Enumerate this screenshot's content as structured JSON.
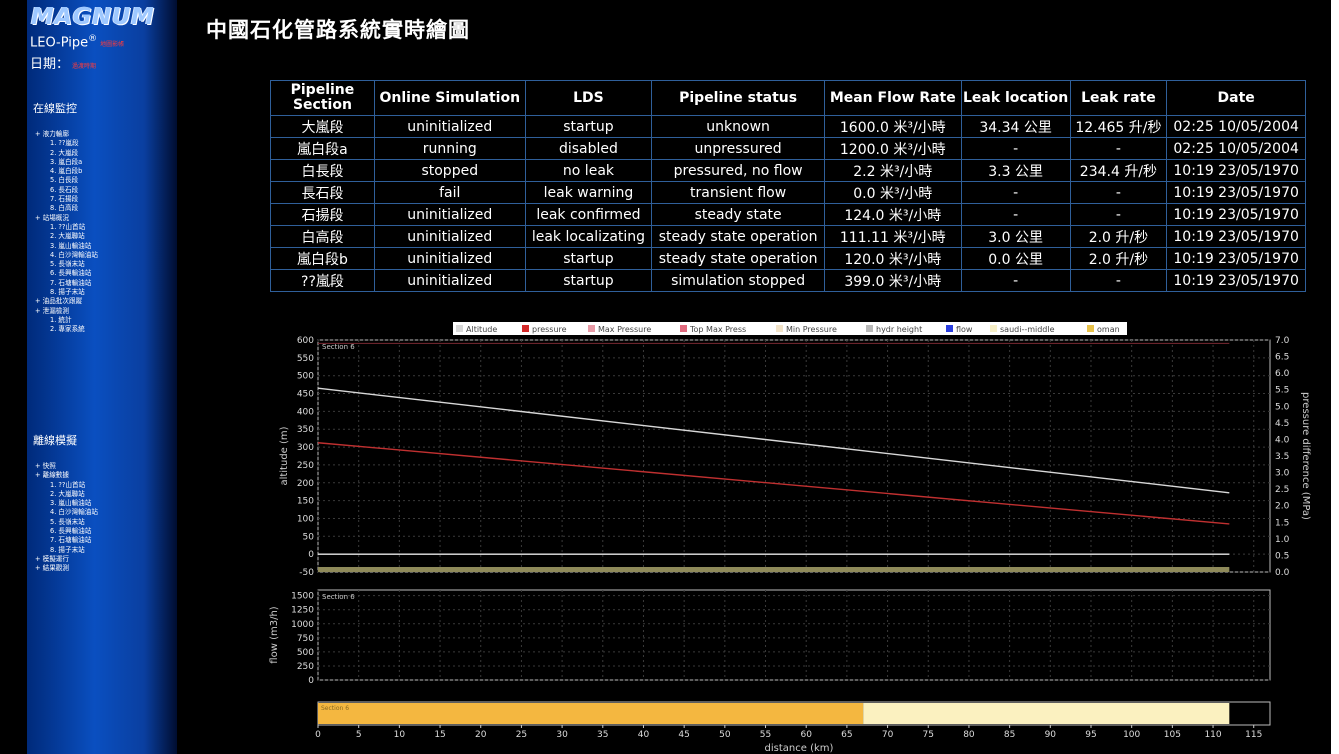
{
  "sidebar": {
    "logo": "MAGNUM",
    "product": "LEO-Pipe",
    "product_mark": "®",
    "product_tag": "地圖影帳",
    "date_label": "日期：",
    "date_value": "過渡時期",
    "section1_title": "在線監控",
    "section1_items": [
      {
        "label": "液力輪廓",
        "level": 1
      },
      {
        "label": "1. ??嵐段",
        "level": 2
      },
      {
        "label": "2. 大嵐段",
        "level": 2
      },
      {
        "label": "3. 嵐白段a",
        "level": 2
      },
      {
        "label": "4. 嵐白段b",
        "level": 2
      },
      {
        "label": "5. 白長段",
        "level": 2
      },
      {
        "label": "6. 長石段",
        "level": 2
      },
      {
        "label": "7. 石揚段",
        "level": 2
      },
      {
        "label": "8. 白高段",
        "level": 2
      },
      {
        "label": "站場概況",
        "level": 1
      },
      {
        "label": "1. ??山首站",
        "level": 2
      },
      {
        "label": "2. 大嵐聯站",
        "level": 2
      },
      {
        "label": "3. 嵐山輸油站",
        "level": 2
      },
      {
        "label": "4. 白沙灣輸油站",
        "level": 2
      },
      {
        "label": "5. 長嶺末站",
        "level": 2
      },
      {
        "label": "6. 長興輸油站",
        "level": 2
      },
      {
        "label": "7. 石塘輸油站",
        "level": 2
      },
      {
        "label": "8. 揚子末站",
        "level": 2
      },
      {
        "label": "油品批次跟蹤",
        "level": 1
      },
      {
        "label": "泄漏檢測",
        "level": 1
      },
      {
        "label": "1. 統計",
        "level": 2
      },
      {
        "label": "2. 專家系統",
        "level": 2
      }
    ],
    "section2_title": "離線模擬",
    "section2_items": [
      {
        "label": "快照",
        "level": 1
      },
      {
        "label": "離線數據",
        "level": 1
      },
      {
        "label": "1. ??山首站",
        "level": 2
      },
      {
        "label": "2. 大嵐聯站",
        "level": 2
      },
      {
        "label": "3. 嵐山輸油站",
        "level": 2
      },
      {
        "label": "4. 白沙灣輸油站",
        "level": 2
      },
      {
        "label": "5. 長嶺末站",
        "level": 2
      },
      {
        "label": "6. 長興輸油站",
        "level": 2
      },
      {
        "label": "7. 石塘輸油站",
        "level": 2
      },
      {
        "label": "8. 揚子末站",
        "level": 2
      },
      {
        "label": "模擬運行",
        "level": 1
      },
      {
        "label": "結果觀測",
        "level": 1
      }
    ]
  },
  "header": {
    "title": "中國石化管路系統實時繪圖"
  },
  "table": {
    "columns": [
      "Pipeline Section",
      "Online Simulation",
      "LDS",
      "Pipeline status",
      "Mean Flow Rate",
      "Leak location",
      "Leak rate",
      "Date"
    ],
    "rows": [
      [
        "大嵐段",
        "uninitialized",
        "startup",
        "unknown",
        "1600.0 米³/小時",
        "34.34 公里",
        "12.465 升/秒",
        "02:25 10/05/2004"
      ],
      [
        "嵐白段a",
        "running",
        "disabled",
        "unpressured",
        "1200.0 米³/小時",
        "-",
        "-",
        "02:25 10/05/2004"
      ],
      [
        "白長段",
        "stopped",
        "no leak",
        "pressured, no flow",
        "2.2 米³/小時",
        "3.3 公里",
        "234.4 升/秒",
        "10:19 23/05/1970"
      ],
      [
        "長石段",
        "fail",
        "leak warning",
        "transient flow",
        "0.0 米³/小時",
        "-",
        "-",
        "10:19 23/05/1970"
      ],
      [
        "石揚段",
        "uninitialized",
        "leak confirmed",
        "steady state",
        "124.0 米³/小時",
        "-",
        "-",
        "10:19 23/05/1970"
      ],
      [
        "白高段",
        "uninitialized",
        "leak localizating",
        "steady state operation",
        "111.11 米³/小時",
        "3.0 公里",
        "2.0 升/秒",
        "10:19 23/05/1970"
      ],
      [
        "嵐白段b",
        "uninitialized",
        "startup",
        "steady state operation",
        "120.0 米³/小時",
        "0.0 公里",
        "2.0 升/秒",
        "10:19 23/05/1970"
      ],
      [
        "??嵐段",
        "uninitialized",
        "startup",
        "simulation stopped",
        "399.0 米³/小時",
        "-",
        "-",
        "10:19 23/05/1970"
      ]
    ]
  },
  "chart_data": [
    {
      "type": "line",
      "panel_label": "Section 6",
      "legend": [
        {
          "name": "Altitude",
          "color": "#d8d8d8"
        },
        {
          "name": "pressure",
          "color": "#d42a2a"
        },
        {
          "name": "Max Pressure",
          "color": "#e89aa6"
        },
        {
          "name": "Top Max Press",
          "color": "#e06a7e"
        },
        {
          "name": "Min Pressure",
          "color": "#f2e3c8"
        },
        {
          "name": "hydr height",
          "color": "#b9b9b9"
        },
        {
          "name": "flow",
          "color": "#2b3fe0"
        },
        {
          "name": "saudi--middle",
          "color": "#f6eec6"
        },
        {
          "name": "oman",
          "color": "#e8c24a"
        }
      ],
      "ylabel": "altitude (m)",
      "y2label": "pressure difference (MPa)",
      "ylim": [
        -50,
        600
      ],
      "yticks": [
        -50,
        0,
        50,
        100,
        150,
        200,
        250,
        300,
        350,
        400,
        450,
        500,
        550,
        600
      ],
      "y2lim": [
        0,
        7
      ],
      "y2ticks": [
        "0.0",
        "0.5",
        "1.0",
        "1.5",
        "2.0",
        "2.5",
        "3.0",
        "3.5",
        "4.0",
        "4.5",
        "5.0",
        "5.5",
        "6.0",
        "6.5",
        "7.0"
      ],
      "xlim": [
        0,
        117
      ],
      "series": [
        {
          "name": "Altitude",
          "x": [
            0,
            112
          ],
          "y": [
            465,
            172
          ]
        },
        {
          "name": "pressure",
          "x": [
            0,
            112
          ],
          "y": [
            3.9,
            1.45
          ],
          "axis": "right"
        },
        {
          "name": "hydr height",
          "x": [
            0,
            112
          ],
          "y": [
            0,
            0
          ]
        },
        {
          "name": "Max Pressure",
          "x": [
            0,
            112
          ],
          "y": [
            6.9,
            6.9
          ],
          "axis": "right"
        }
      ],
      "grid": true
    },
    {
      "type": "line",
      "panel_label": "Section 6",
      "ylabel": "flow (m3/h)",
      "ylim": [
        0,
        1600
      ],
      "yticks": [
        0,
        250,
        500,
        750,
        1000,
        1250,
        1500
      ],
      "xlim": [
        0,
        117
      ],
      "series": [],
      "grid": true
    },
    {
      "type": "bar",
      "panel_label": "Section 6",
      "segments": [
        {
          "name": "oman",
          "from": 0,
          "to": 67,
          "color": "#f4b740"
        },
        {
          "name": "saudi--middle",
          "from": 67,
          "to": 112,
          "color": "#fbf1c0"
        }
      ],
      "xlabel": "distance (km)",
      "xlim": [
        0,
        117
      ],
      "xticks": [
        0,
        5,
        10,
        15,
        20,
        25,
        30,
        35,
        40,
        45,
        50,
        55,
        60,
        65,
        70,
        75,
        80,
        85,
        90,
        95,
        100,
        105,
        110,
        115
      ]
    }
  ]
}
